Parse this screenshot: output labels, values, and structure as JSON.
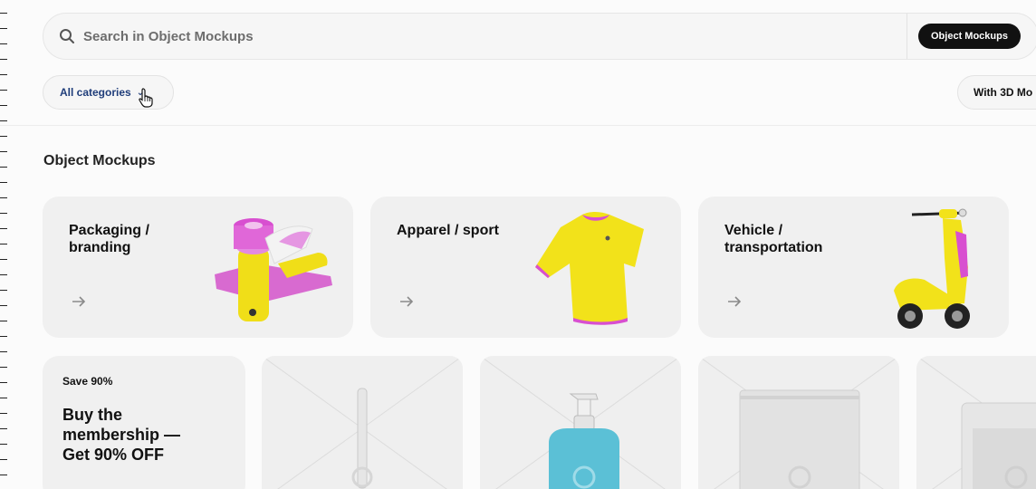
{
  "search": {
    "placeholder": "Search in Object Mockups",
    "scope_label": "Object Mockups"
  },
  "filters": {
    "category_label": "All categories",
    "three_d_label": "With 3D Mo"
  },
  "section": {
    "title": "Object Mockups"
  },
  "categories": [
    {
      "label": "Packaging / branding"
    },
    {
      "label": "Apparel / sport"
    },
    {
      "label": "Vehicle / transportation"
    }
  ],
  "promo": {
    "save_text": "Save 90%",
    "headline": "Buy the membership — Get 90% OFF"
  },
  "colors": {
    "accent_yellow": "#f2e21a",
    "accent_magenta": "#d84fd0",
    "scope_button": "#111111",
    "category_text": "#1f3d7a"
  }
}
